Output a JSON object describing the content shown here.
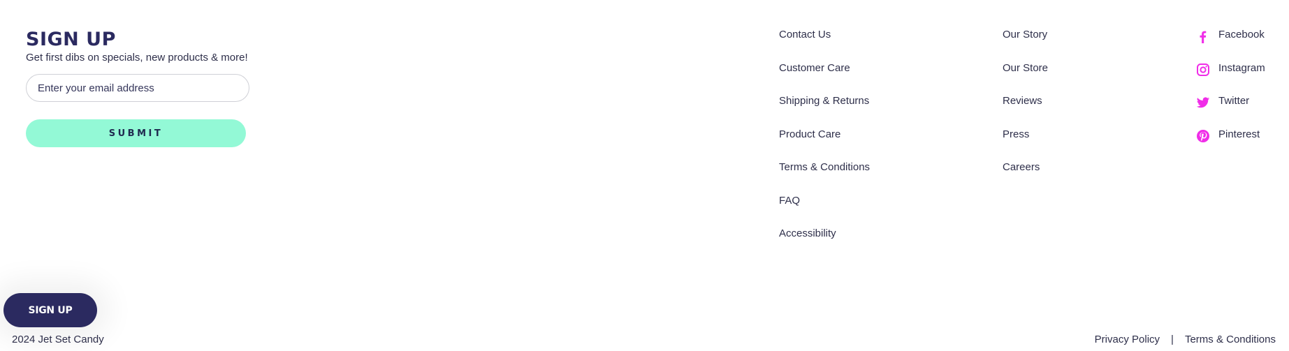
{
  "signup": {
    "title": "SIGN UP",
    "subtitle": "Get first dibs on specials, new products & more!",
    "email_placeholder": "Enter your email address",
    "email_value": "",
    "submit_label": "SUBMIT"
  },
  "links_col1": [
    {
      "label": "Contact Us"
    },
    {
      "label": "Customer Care"
    },
    {
      "label": "Shipping & Returns"
    },
    {
      "label": "Product Care"
    },
    {
      "label": "Terms & Conditions"
    },
    {
      "label": "FAQ"
    },
    {
      "label": "Accessibility"
    }
  ],
  "links_col2": [
    {
      "label": "Our Story"
    },
    {
      "label": "Our Store"
    },
    {
      "label": "Reviews"
    },
    {
      "label": "Press"
    },
    {
      "label": "Careers"
    }
  ],
  "social": [
    {
      "label": "Facebook",
      "icon": "facebook-icon"
    },
    {
      "label": "Instagram",
      "icon": "instagram-icon"
    },
    {
      "label": "Twitter",
      "icon": "twitter-icon"
    },
    {
      "label": "Pinterest",
      "icon": "pinterest-icon"
    }
  ],
  "floating_button": {
    "label": "SIGN UP"
  },
  "footer": {
    "copyright": "2024 Jet Set Candy",
    "privacy_label": "Privacy Policy",
    "separator": "|",
    "terms_label": "Terms & Conditions"
  },
  "colors": {
    "brand_navy": "#2b2a60",
    "accent_mint": "#93f9d6",
    "social_magenta": "#f02de8",
    "text": "#2e2f4a"
  }
}
